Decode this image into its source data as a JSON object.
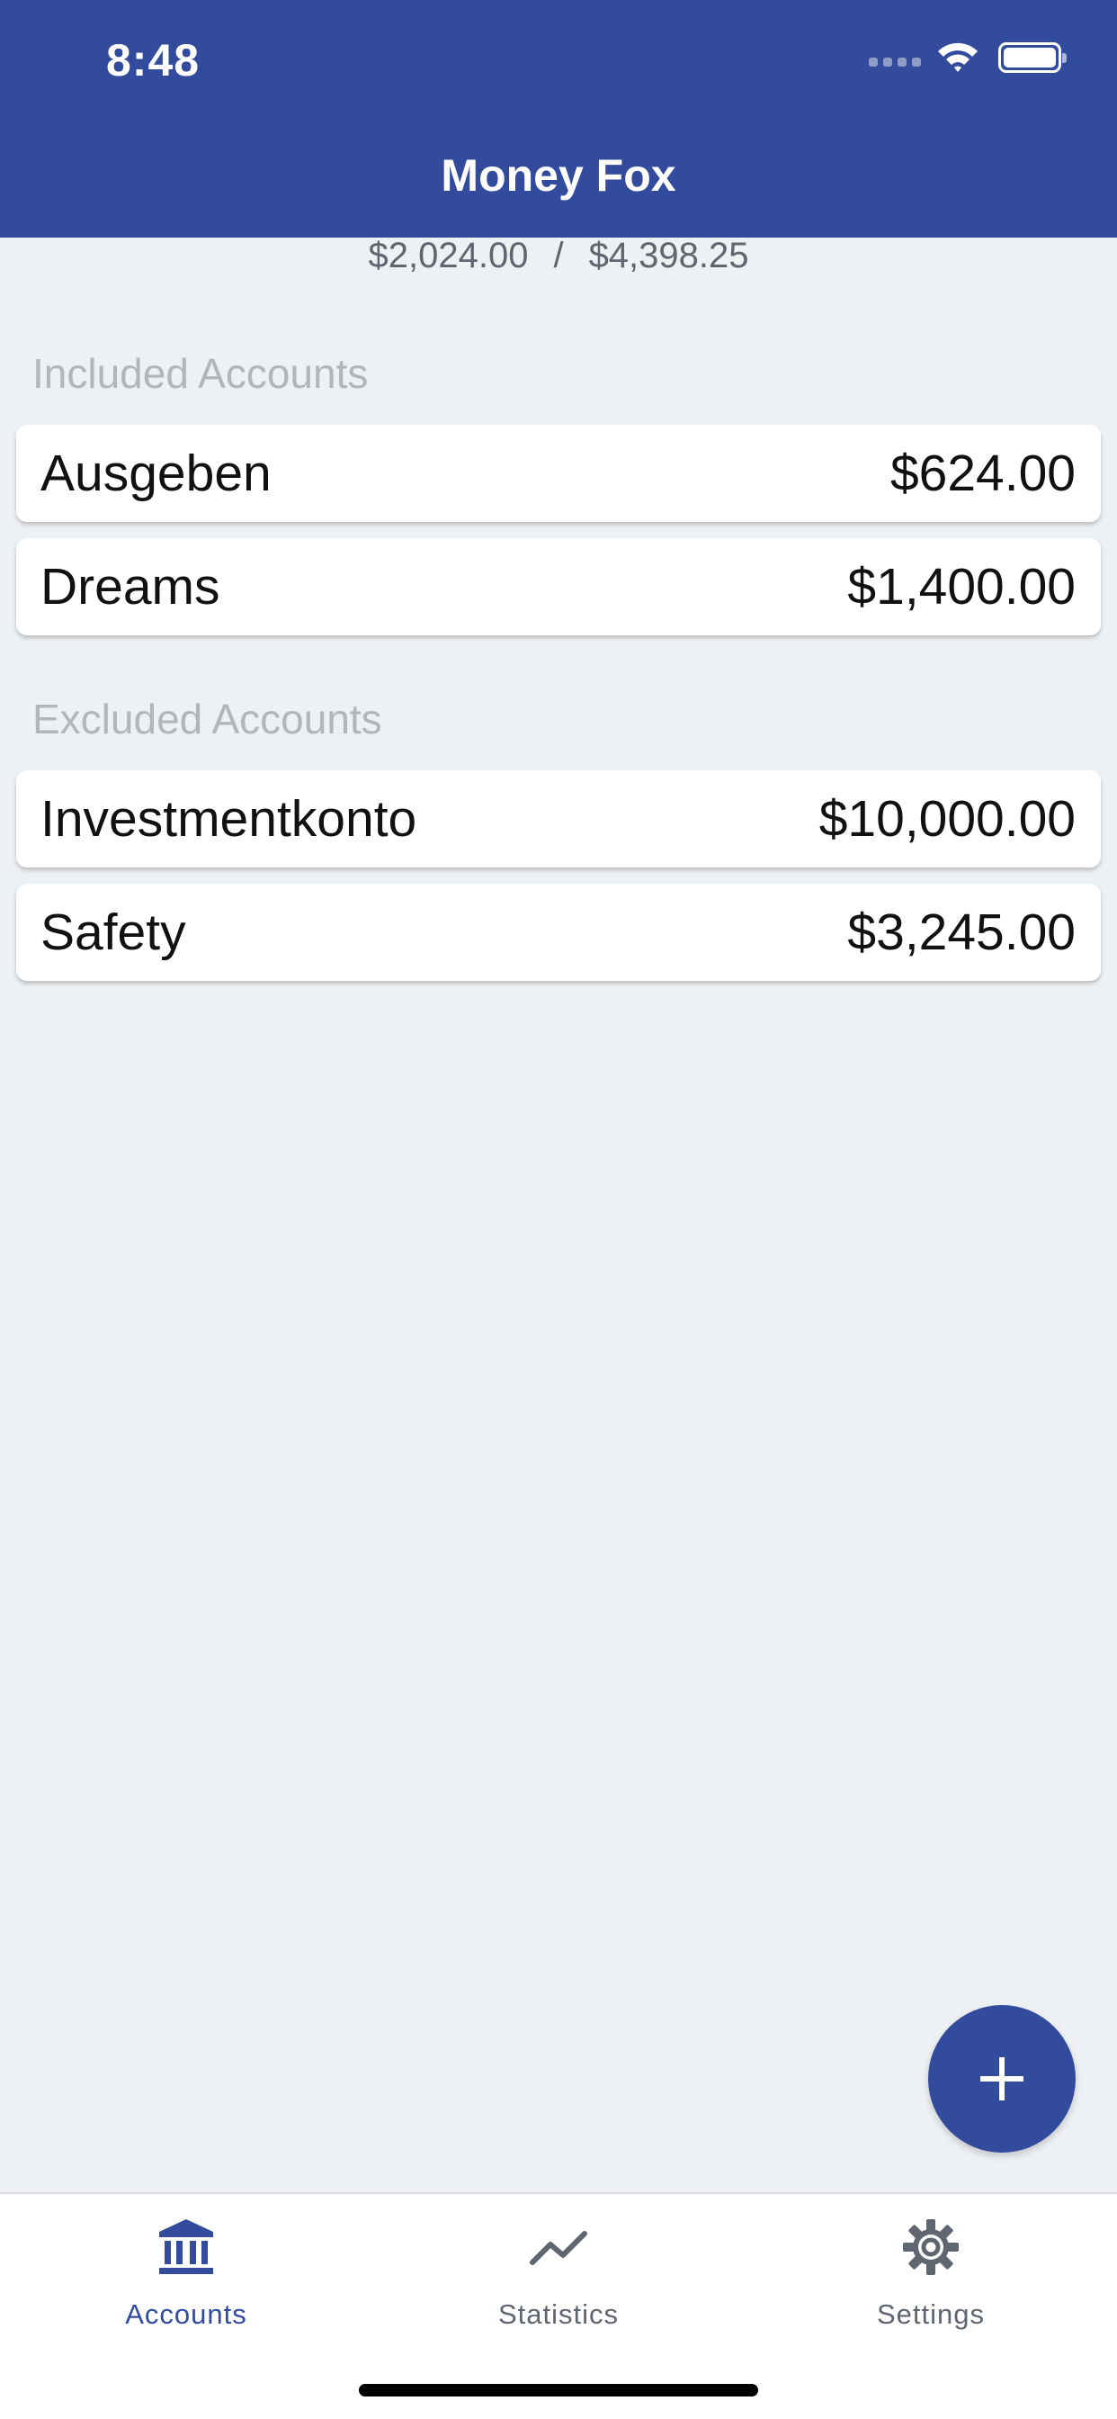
{
  "status_bar": {
    "time": "8:48"
  },
  "header": {
    "title": "Money Fox"
  },
  "balance": {
    "current": "$2,024.00",
    "separator": "/",
    "end_of_month": "$4,398.25"
  },
  "sections": {
    "included": {
      "title": "Included Accounts",
      "accounts": [
        {
          "name": "Ausgeben",
          "amount": "$624.00"
        },
        {
          "name": "Dreams",
          "amount": "$1,400.00"
        }
      ]
    },
    "excluded": {
      "title": "Excluded Accounts",
      "accounts": [
        {
          "name": "Investmentkonto",
          "amount": "$10,000.00"
        },
        {
          "name": "Safety",
          "amount": "$3,245.00"
        }
      ]
    }
  },
  "fab": {
    "icon": "plus-icon"
  },
  "tabs": [
    {
      "label": "Accounts",
      "icon": "bank-icon",
      "active": true
    },
    {
      "label": "Statistics",
      "icon": "line-chart-icon",
      "active": false
    },
    {
      "label": "Settings",
      "icon": "gear-icon",
      "active": false
    }
  ],
  "colors": {
    "primary": "#334b9c",
    "background": "#eef1f4",
    "section_title": "#b3b5b8",
    "muted_text": "#5f6670"
  }
}
